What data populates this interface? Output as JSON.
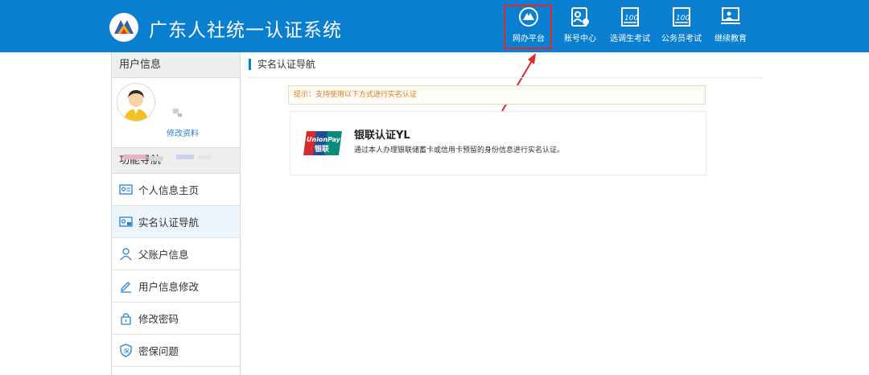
{
  "header": {
    "title": "广东人社统一认证系统",
    "nav": [
      {
        "label": "网办平台",
        "icon": "handshake-icon",
        "active": true
      },
      {
        "label": "账号中心",
        "icon": "id-card-icon",
        "active": false
      },
      {
        "label": "选调生考试",
        "icon": "exam-icon",
        "active": false
      },
      {
        "label": "公务员考试",
        "icon": "exam-icon",
        "active": false
      },
      {
        "label": "继续教育",
        "icon": "education-icon",
        "active": false
      }
    ]
  },
  "sidebar": {
    "user_section_title": "用户信息",
    "edit_profile_label": "修改资料",
    "nav_section_title": "功能导航",
    "items": [
      {
        "label": "个人信息主页",
        "icon": "profile-card-icon"
      },
      {
        "label": "实名认证导航",
        "icon": "realname-card-icon",
        "active": true
      },
      {
        "label": "父账户信息",
        "icon": "user-icon"
      },
      {
        "label": "用户信息修改",
        "icon": "pencil-icon"
      },
      {
        "label": "修改密码",
        "icon": "lock-icon"
      },
      {
        "label": "密保问题",
        "icon": "shield-icon"
      }
    ]
  },
  "main": {
    "title": "实名认证导航",
    "tip": "提示：支持使用以下方式进行实名认证",
    "method": {
      "logo_text_top": "UnionPay",
      "logo_text_bottom": "银联",
      "title": "银联认证YL",
      "description": "通过本人办理银联储蓄卡或信用卡预留的身份信息进行实名认证。"
    }
  },
  "colors": {
    "primary": "#0a7fd0",
    "tip": "#e07a1e",
    "highlight": "#e02828"
  }
}
